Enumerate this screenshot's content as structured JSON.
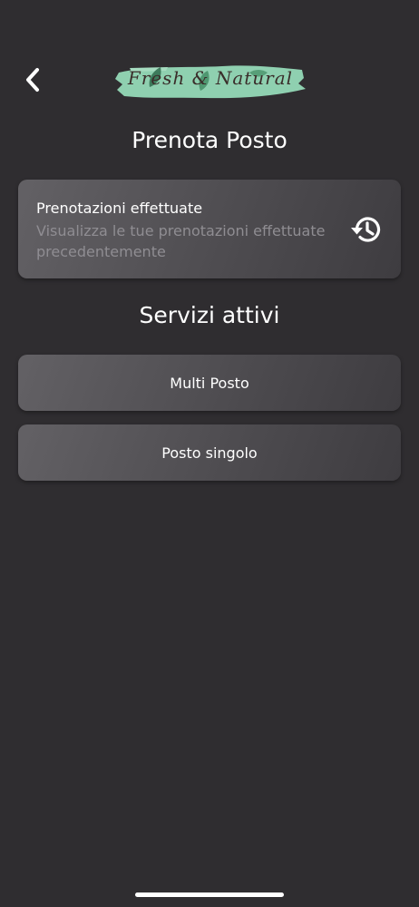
{
  "header": {
    "back_icon": "chevron-left-icon",
    "logo_text": "Fresh & Natural"
  },
  "title": "Prenota Posto",
  "history_card": {
    "title": "Prenotazioni effettuate",
    "subtitle": "Visualizza le tue prenotazioni effettuate precedentemente",
    "icon": "history-icon"
  },
  "services": {
    "heading": "Servizi attivi",
    "items": [
      {
        "label": "Multi Posto"
      },
      {
        "label": "Posto singolo"
      }
    ]
  },
  "colors": {
    "background": "#2f2d30",
    "card": "#5a585c",
    "subtitle": "#8f8d92",
    "logo_green": "#8fd0b0"
  }
}
